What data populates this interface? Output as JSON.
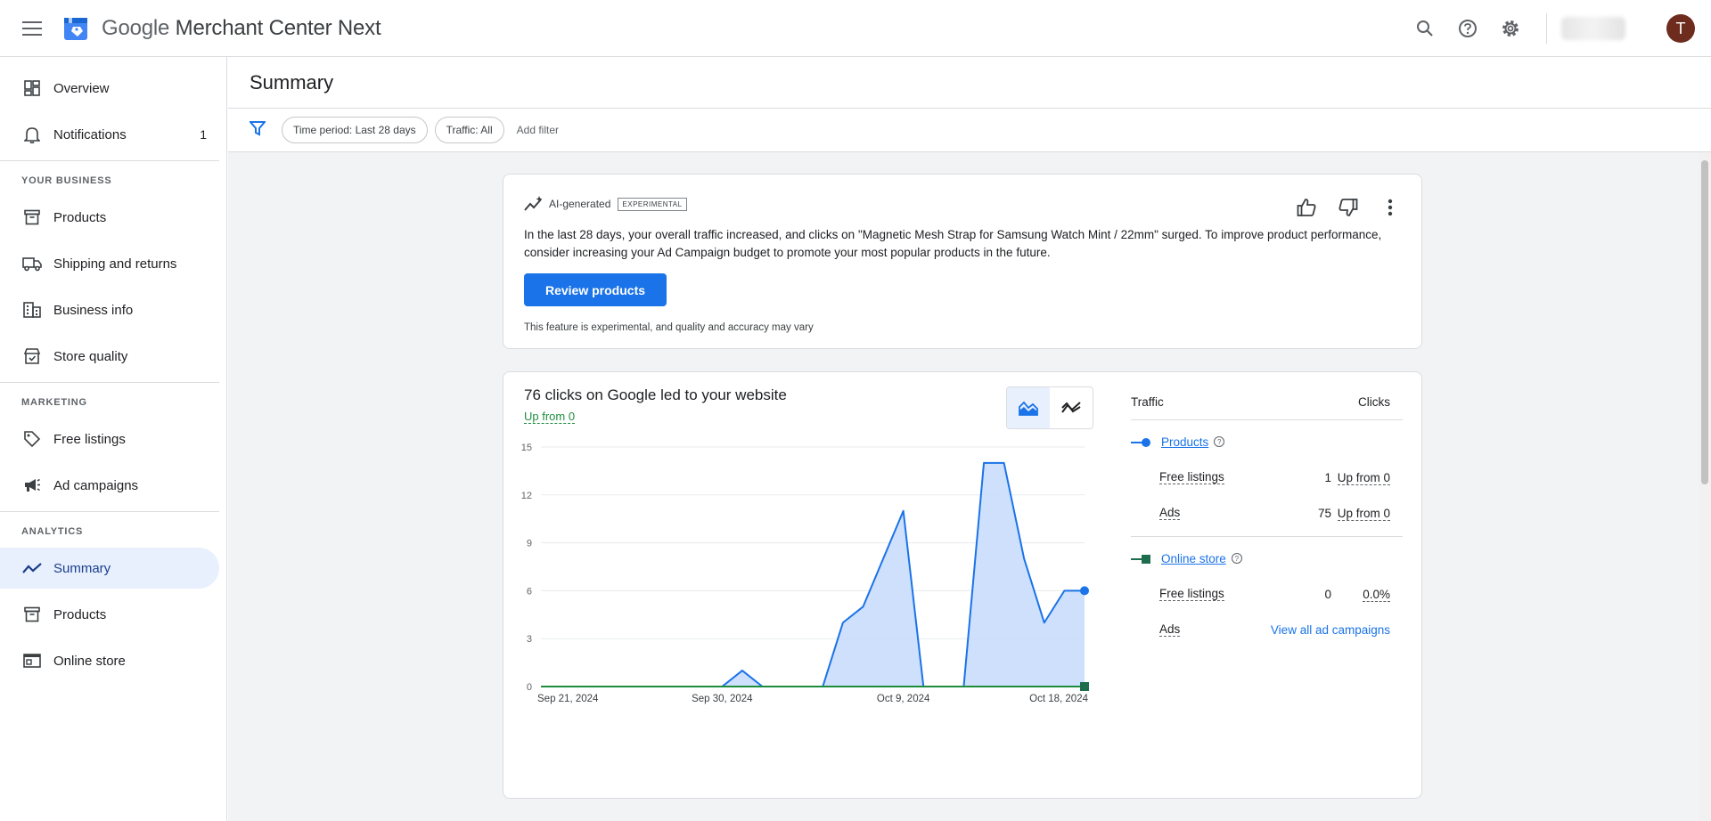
{
  "header": {
    "brand_google": "Google",
    "brand_rest": "Merchant Center Next",
    "avatar_initial": "T",
    "icons": [
      "menu-icon",
      "search-icon",
      "help-icon",
      "settings-icon"
    ]
  },
  "sidebar": {
    "overview": "Overview",
    "notifications": "Notifications",
    "notifications_count": "1",
    "section_business": "YOUR BUSINESS",
    "products": "Products",
    "shipping": "Shipping and returns",
    "business_info": "Business info",
    "store_quality": "Store quality",
    "section_marketing": "MARKETING",
    "free_listings": "Free listings",
    "ad_campaigns": "Ad campaigns",
    "section_analytics": "ANALYTICS",
    "summary": "Summary",
    "analytics_products": "Products",
    "online_store": "Online store"
  },
  "main": {
    "title": "Summary",
    "filters": {
      "time_period": "Time period: Last 28 days",
      "traffic": "Traffic: All",
      "add_filter": "Add filter"
    }
  },
  "ai_card": {
    "label": "AI-generated",
    "badge": "EXPERIMENTAL",
    "text": "In the last 28 days, your overall traffic increased, and clicks on \"Magnetic Mesh Strap for Samsung Watch Mint / 22mm\" surged. To improve product performance, consider increasing your Ad Campaign budget to promote your most popular products in the future.",
    "button": "Review products",
    "note": "This feature is experimental, and quality and accuracy may vary"
  },
  "clicks_card": {
    "title": "76 clicks on Google led to your website",
    "subtitle": "Up from 0",
    "traffic_table": {
      "col_traffic": "Traffic",
      "col_clicks": "Clicks",
      "products": {
        "label": "Products",
        "rows": [
          {
            "label": "Free listings",
            "value": "1",
            "change": "Up from 0"
          },
          {
            "label": "Ads",
            "value": "75",
            "change": "Up from 0"
          }
        ]
      },
      "online_store": {
        "label": "Online store",
        "rows": [
          {
            "label": "Free listings",
            "value": "0",
            "change": "0.0%"
          },
          {
            "label": "Ads",
            "link": "View all ad campaigns"
          }
        ]
      }
    }
  },
  "chart_data": {
    "type": "area",
    "x_ticks": [
      "Sep 21, 2024",
      "Sep 30, 2024",
      "Oct 9, 2024",
      "Oct 18, 2024"
    ],
    "y_ticks": [
      "0",
      "3",
      "6",
      "9",
      "12",
      "15"
    ],
    "ylim": [
      0,
      15
    ],
    "x_range": [
      "2024-09-21",
      "2024-10-18"
    ],
    "series": [
      {
        "name": "Products",
        "color": "#1a73e8",
        "fill": "#c6dafc",
        "x": [
          "2024-09-21",
          "2024-09-22",
          "2024-09-23",
          "2024-09-24",
          "2024-09-25",
          "2024-09-26",
          "2024-09-27",
          "2024-09-28",
          "2024-09-29",
          "2024-09-30",
          "2024-10-01",
          "2024-10-02",
          "2024-10-03",
          "2024-10-04",
          "2024-10-05",
          "2024-10-06",
          "2024-10-07",
          "2024-10-08",
          "2024-10-09",
          "2024-10-10",
          "2024-10-11",
          "2024-10-12",
          "2024-10-13",
          "2024-10-14",
          "2024-10-15",
          "2024-10-16",
          "2024-10-17",
          "2024-10-18"
        ],
        "values": [
          0,
          0,
          0,
          0,
          0,
          0,
          0,
          0,
          0,
          0,
          1,
          0,
          0,
          0,
          0,
          4,
          5,
          8,
          11,
          0,
          0,
          0,
          14,
          14,
          8,
          4,
          6,
          6
        ]
      },
      {
        "name": "Online store",
        "color": "#1e8e3e",
        "x": [
          "2024-09-21",
          "2024-10-18"
        ],
        "values": [
          0,
          0
        ]
      }
    ]
  }
}
